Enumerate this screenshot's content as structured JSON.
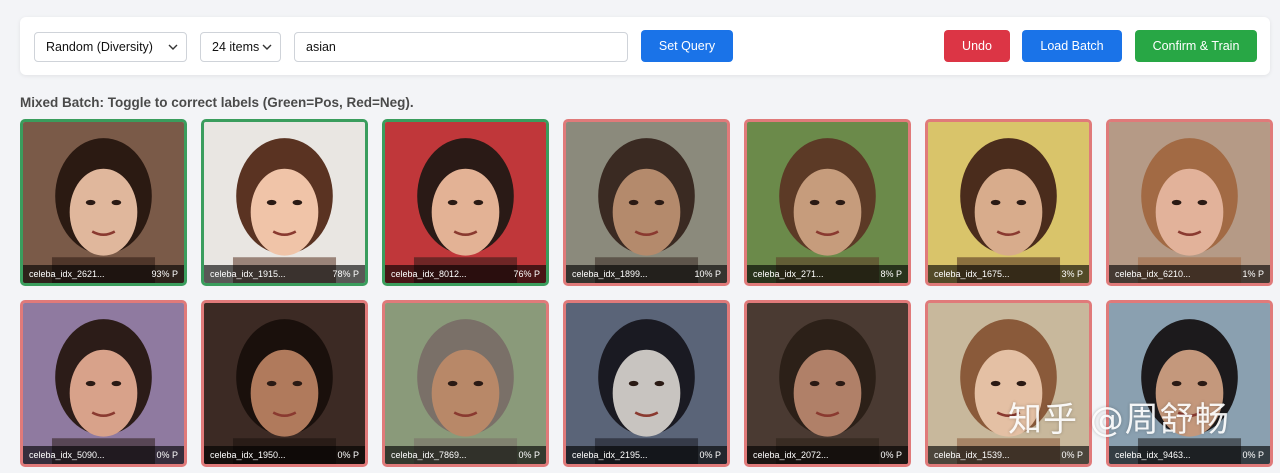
{
  "toolbar": {
    "strategy_value": "Random (Diversity)",
    "count_value": "24 items",
    "query_value": "asian",
    "set_query_label": "Set Query",
    "undo_label": "Undo",
    "load_batch_label": "Load Batch",
    "confirm_label": "Confirm & Train"
  },
  "heading": "Mixed Batch: Toggle to correct labels (Green=Pos, Red=Neg).",
  "colors": {
    "primary": "#1a73e8",
    "danger": "#dc3545",
    "success": "#28a745",
    "positive_border": "#3a9d5d",
    "negative_border": "#e07a7a"
  },
  "cards": [
    {
      "id": "celeba_idx_2621...",
      "prob": "93% P",
      "label": "positive"
    },
    {
      "id": "celeba_idx_1915...",
      "prob": "78% P",
      "label": "positive"
    },
    {
      "id": "celeba_idx_8012...",
      "prob": "76% P",
      "label": "positive"
    },
    {
      "id": "celeba_idx_1899...",
      "prob": "10% P",
      "label": "negative"
    },
    {
      "id": "celeba_idx_271...",
      "prob": "8% P",
      "label": "negative"
    },
    {
      "id": "celeba_idx_1675...",
      "prob": "3% P",
      "label": "negative"
    },
    {
      "id": "celeba_idx_6210...",
      "prob": "1% P",
      "label": "negative"
    },
    {
      "id": "celeba_idx_5090...",
      "prob": "0% P",
      "label": "negative"
    },
    {
      "id": "celeba_idx_1950...",
      "prob": "0% P",
      "label": "negative"
    },
    {
      "id": "celeba_idx_7869...",
      "prob": "0% P",
      "label": "negative"
    },
    {
      "id": "celeba_idx_2195...",
      "prob": "0% P",
      "label": "negative"
    },
    {
      "id": "celeba_idx_2072...",
      "prob": "0% P",
      "label": "negative"
    },
    {
      "id": "celeba_idx_1539...",
      "prob": "0% P",
      "label": "negative"
    },
    {
      "id": "celeba_idx_9463...",
      "prob": "0% P",
      "label": "negative"
    }
  ],
  "watermark": "知乎 @周舒畅"
}
